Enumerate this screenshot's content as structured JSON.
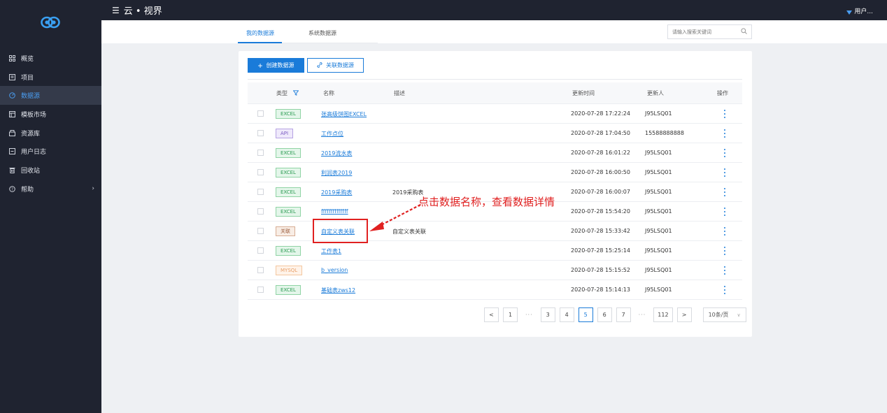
{
  "app": {
    "brand": "云 • 视界",
    "user": "用户..."
  },
  "sidebar": {
    "items": [
      {
        "label": "概览",
        "icon": "grid-icon",
        "active": false
      },
      {
        "label": "项目",
        "icon": "project-icon",
        "active": false
      },
      {
        "label": "数据源",
        "icon": "datasource-icon",
        "active": true
      },
      {
        "label": "模板市场",
        "icon": "template-icon",
        "active": false
      },
      {
        "label": "资源库",
        "icon": "resource-icon",
        "active": false
      },
      {
        "label": "用户日志",
        "icon": "log-icon",
        "active": false
      },
      {
        "label": "回收站",
        "icon": "trash-icon",
        "active": false
      },
      {
        "label": "帮助",
        "icon": "help-icon",
        "active": false,
        "has_submenu": true
      }
    ]
  },
  "tabs": {
    "items": [
      {
        "label": "我的数据源",
        "active": true
      },
      {
        "label": "系统数据源",
        "active": false
      }
    ]
  },
  "search": {
    "placeholder": "请输入搜索关键词"
  },
  "toolbar": {
    "create_label": "创建数据源",
    "link_label": "关联数据源"
  },
  "table": {
    "headers": {
      "type": "类型",
      "name": "名称",
      "desc": "描述",
      "time": "更新时间",
      "updater": "更新人",
      "ops": "操作"
    },
    "rows": [
      {
        "type": "EXCEL",
        "kind": "excel",
        "name": "张高级饼图EXCEL",
        "desc": "",
        "time": "2020-07-28 17:22:24",
        "updater": "J95LSQ01"
      },
      {
        "type": "API",
        "kind": "api",
        "name": "工作点位",
        "desc": "",
        "time": "2020-07-28 17:04:50",
        "updater": "15588888888"
      },
      {
        "type": "EXCEL",
        "kind": "excel",
        "name": "2019流水表",
        "desc": "",
        "time": "2020-07-28 16:01:22",
        "updater": "J95LSQ01"
      },
      {
        "type": "EXCEL",
        "kind": "excel",
        "name": "利润表2019",
        "desc": "",
        "time": "2020-07-28 16:00:50",
        "updater": "J95LSQ01"
      },
      {
        "type": "EXCEL",
        "kind": "excel",
        "name": "2019采购表",
        "desc": "2019采购表",
        "time": "2020-07-28 16:00:07",
        "updater": "J95LSQ01"
      },
      {
        "type": "EXCEL",
        "kind": "excel",
        "name": "ffffffffffffff",
        "desc": "",
        "time": "2020-07-28 15:54:20",
        "updater": "J95LSQ01"
      },
      {
        "type": "关联",
        "kind": "join",
        "name": "自定义表关联",
        "desc": "自定义表关联",
        "time": "2020-07-28 15:33:42",
        "updater": "J95LSQ01"
      },
      {
        "type": "EXCEL",
        "kind": "excel",
        "name": "工作表1",
        "desc": "",
        "time": "2020-07-28 15:25:14",
        "updater": "J95LSQ01"
      },
      {
        "type": "MYSQL",
        "kind": "mysql",
        "name": "b_version",
        "desc": "",
        "time": "2020-07-28 15:15:52",
        "updater": "J95LSQ01"
      },
      {
        "type": "EXCEL",
        "kind": "excel",
        "name": "基础表zws12",
        "desc": "",
        "time": "2020-07-28 15:14:13",
        "updater": "J95LSQ01"
      }
    ]
  },
  "pagination": {
    "prev": "<",
    "next": ">",
    "pages": [
      "1",
      "···",
      "3",
      "4",
      "5",
      "6",
      "7",
      "···",
      "112"
    ],
    "current": "5",
    "page_size": "10条/页"
  },
  "annotation": {
    "text": "点击数据名称，查看数据详情"
  },
  "colors": {
    "accent": "#1a7bd9",
    "sidebar_bg": "#1f2330",
    "annotation": "#e02020"
  }
}
